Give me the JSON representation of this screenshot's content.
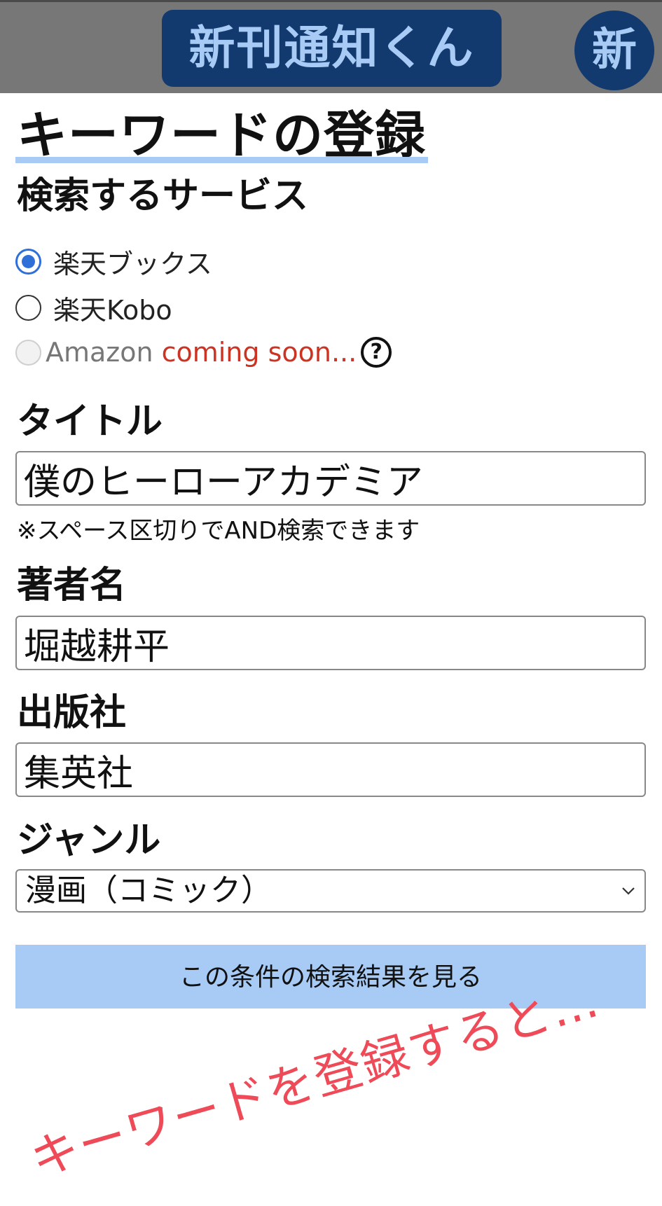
{
  "header": {
    "app_title": "新刊通知くん",
    "new_badge": "新"
  },
  "page": {
    "title": "キーワードの登録"
  },
  "service": {
    "label": "検索するサービス",
    "options": [
      {
        "label": "楽天ブックス",
        "checked": true,
        "disabled": false
      },
      {
        "label": "楽天Kobo",
        "checked": false,
        "disabled": false
      },
      {
        "label": "Amazon",
        "checked": false,
        "disabled": true,
        "note": "coming soon...",
        "help_icon": "question-circle-icon"
      }
    ],
    "help_glyph": "?"
  },
  "title_field": {
    "label": "タイトル",
    "value": "僕のヒーローアカデミア",
    "hint": "※スペース区切りでAND検索できます"
  },
  "author_field": {
    "label": "著者名",
    "value": "堀越耕平"
  },
  "publisher_field": {
    "label": "出版社",
    "value": "集英社"
  },
  "genre_field": {
    "label": "ジャンル",
    "selected": "漫画（コミック）"
  },
  "search_button": {
    "label": "この条件の検索結果を見る"
  },
  "annotation": {
    "text": "キーワードを登録すると…"
  },
  "colors": {
    "header_bg": "#777777",
    "brand_navy": "#123a6e",
    "brand_light_blue": "#a8cbf5",
    "radio_selected": "#2f6fd8",
    "coming_soon": "#cc3322",
    "annotation": "#ee4a57"
  }
}
